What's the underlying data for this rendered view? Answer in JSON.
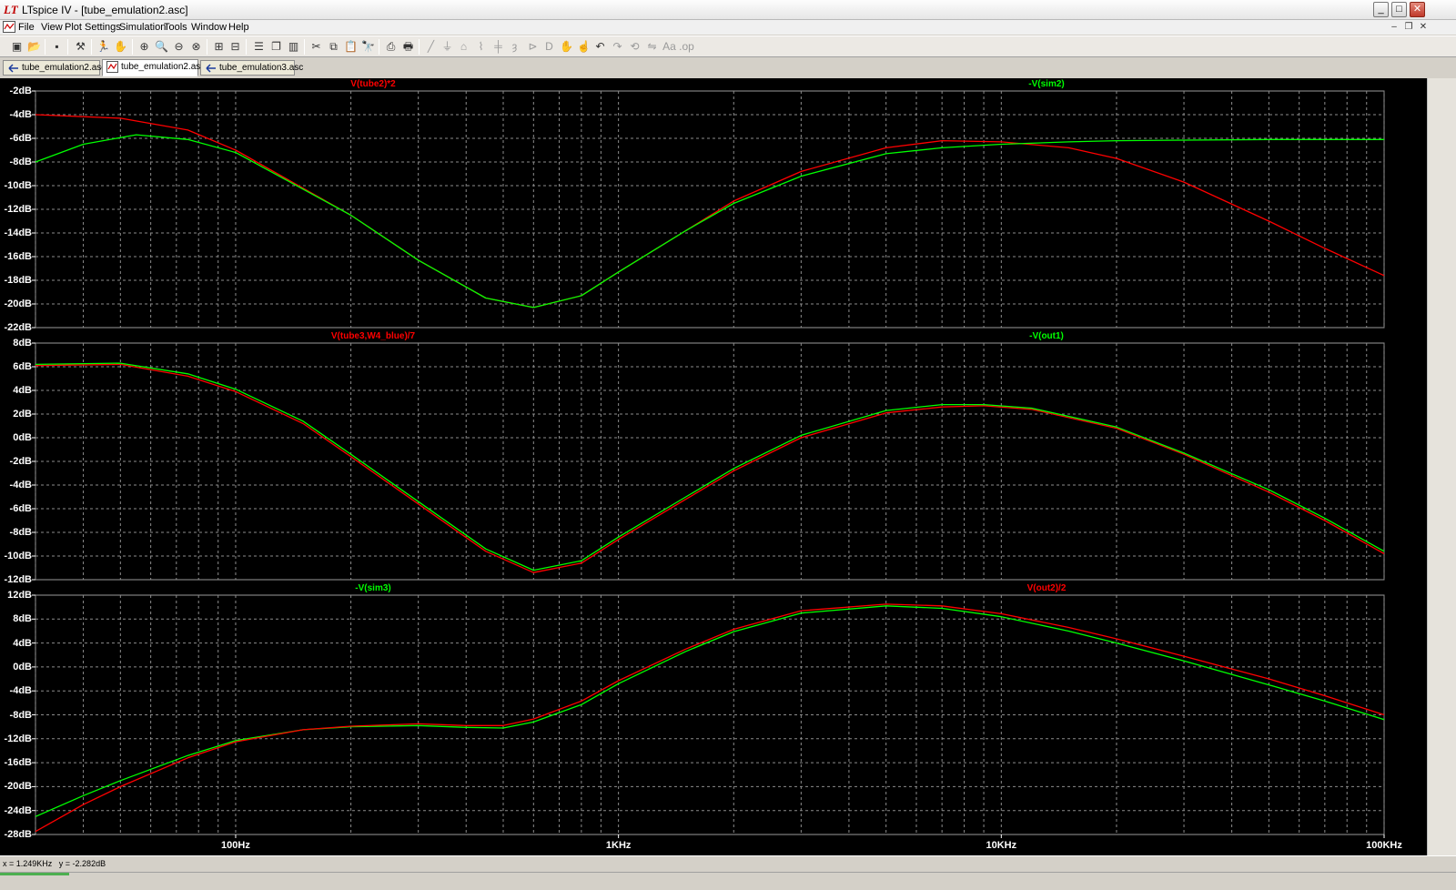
{
  "window": {
    "title": "LTspice IV - [tube_emulation2.asc]",
    "buttons": {
      "minimize": "_",
      "maximize": "□",
      "close": "✕"
    }
  },
  "menu": {
    "items": [
      "File",
      "View",
      "Plot Settings",
      "Simulation",
      "Tools",
      "Window",
      "Help"
    ],
    "mdi_buttons": [
      "–",
      "❐",
      "✕"
    ]
  },
  "toolbar": {
    "icons": [
      "new-schematic",
      "open",
      "save",
      "control-panel",
      "run",
      "halt",
      "zoom-in",
      "zoom-pan",
      "zoom-out",
      "zoom-fit",
      "autorange",
      "zoom-cancel",
      "tile-horizontal",
      "cascade",
      "tile-vertical",
      "cut",
      "copy",
      "paste",
      "find",
      "print-preview",
      "print",
      "wire",
      "ground",
      "label-net",
      "resistor",
      "capacitor",
      "inductor",
      "diode",
      "component",
      "move",
      "drag",
      "undo",
      "redo",
      "rotate",
      "mirror",
      "text",
      "spice-directive"
    ]
  },
  "tabs": [
    {
      "label": "tube_emulation2.asc",
      "kind": "schematic"
    },
    {
      "label": "tube_emulation2.asc",
      "kind": "waveform",
      "active": true
    },
    {
      "label": "tube_emulation3.asc",
      "kind": "schematic"
    }
  ],
  "status": {
    "x_readout": "x = 1.249KHz",
    "y_readout": "y = -2.282dB"
  },
  "colors": {
    "background": "#000000",
    "grid": "#8c8c8c",
    "red_trace": "#ff0000",
    "green_trace": "#00ff00"
  },
  "chart_data": [
    {
      "type": "line",
      "x_scale": "log",
      "xlim": [
        30,
        100000
      ],
      "ylim": [
        -22,
        -2
      ],
      "y_unit": "dB",
      "y_ticks": [
        "-2dB",
        "-4dB",
        "-6dB",
        "-8dB",
        "-10dB",
        "-12dB",
        "-14dB",
        "-16dB",
        "-18dB",
        "-20dB",
        "-22dB"
      ],
      "series": [
        {
          "name": "V(tube2)*2",
          "color": "red",
          "x": [
            30,
            50,
            75,
            100,
            200,
            300,
            450,
            600,
            800,
            1000,
            1500,
            2000,
            3000,
            5000,
            7000,
            10000,
            15000,
            20000,
            30000,
            50000,
            70000,
            100000
          ],
          "y": [
            -4.0,
            -4.3,
            -5.3,
            -7.0,
            -12.5,
            -16.3,
            -19.5,
            -20.3,
            -19.3,
            -17.3,
            -13.8,
            -11.3,
            -8.8,
            -6.8,
            -6.2,
            -6.3,
            -6.8,
            -7.7,
            -9.7,
            -13.0,
            -15.3,
            -17.6
          ]
        },
        {
          "name": "-V(sim2)",
          "color": "green",
          "x": [
            30,
            40,
            55,
            75,
            100,
            200,
            300,
            450,
            600,
            800,
            1000,
            1500,
            2000,
            3000,
            5000,
            7000,
            10000,
            15000,
            20000,
            50000,
            100000
          ],
          "y": [
            -8.0,
            -6.5,
            -5.7,
            -6.1,
            -7.2,
            -12.5,
            -16.3,
            -19.5,
            -20.3,
            -19.3,
            -17.3,
            -13.8,
            -11.5,
            -9.2,
            -7.3,
            -6.8,
            -6.5,
            -6.3,
            -6.2,
            -6.1,
            -6.1
          ]
        }
      ]
    },
    {
      "type": "line",
      "x_scale": "log",
      "xlim": [
        30,
        100000
      ],
      "ylim": [
        -12,
        8
      ],
      "y_unit": "dB",
      "y_ticks": [
        "8dB",
        "6dB",
        "4dB",
        "2dB",
        "0dB",
        "-2dB",
        "-4dB",
        "-6dB",
        "-8dB",
        "-10dB",
        "-12dB"
      ],
      "series": [
        {
          "name": "V(tube3,W4_blue)/7",
          "color": "red",
          "x": [
            30,
            50,
            75,
            100,
            150,
            200,
            300,
            450,
            600,
            800,
            1000,
            1500,
            2000,
            3000,
            5000,
            7000,
            9000,
            12000,
            20000,
            30000,
            50000,
            70000,
            100000
          ],
          "y": [
            6.1,
            6.2,
            5.2,
            3.9,
            1.2,
            -1.6,
            -5.6,
            -9.6,
            -11.4,
            -10.6,
            -8.6,
            -5.2,
            -2.8,
            0.0,
            2.1,
            2.6,
            2.7,
            2.4,
            0.8,
            -1.4,
            -4.6,
            -7.0,
            -9.8
          ]
        },
        {
          "name": "-V(out1)",
          "color": "green",
          "x": [
            30,
            50,
            75,
            100,
            150,
            200,
            300,
            450,
            600,
            800,
            1000,
            1500,
            2000,
            3000,
            5000,
            7000,
            9000,
            12000,
            20000,
            30000,
            50000,
            70000,
            100000
          ],
          "y": [
            6.2,
            6.3,
            5.4,
            4.1,
            1.4,
            -1.4,
            -5.4,
            -9.4,
            -11.2,
            -10.4,
            -8.4,
            -5.0,
            -2.6,
            0.2,
            2.3,
            2.8,
            2.8,
            2.5,
            0.9,
            -1.3,
            -4.4,
            -6.8,
            -9.6
          ]
        }
      ]
    },
    {
      "type": "line",
      "x_scale": "log",
      "xlim": [
        30,
        100000
      ],
      "ylim": [
        -28,
        12
      ],
      "y_unit": "dB",
      "y_ticks": [
        "12dB",
        "8dB",
        "4dB",
        "0dB",
        "-4dB",
        "-8dB",
        "-12dB",
        "-16dB",
        "-20dB",
        "-24dB",
        "-28dB"
      ],
      "series": [
        {
          "name": "-V(sim3)",
          "color": "green",
          "x": [
            30,
            40,
            50,
            75,
            100,
            150,
            200,
            300,
            400,
            500,
            600,
            800,
            1000,
            1500,
            2000,
            3000,
            5000,
            7000,
            10000,
            15000,
            20000,
            30000,
            50000,
            70000,
            100000
          ],
          "y": [
            -25.0,
            -21.5,
            -19.0,
            -14.8,
            -12.3,
            -10.5,
            -10.0,
            -9.8,
            -10.1,
            -10.2,
            -9.2,
            -6.3,
            -2.8,
            2.6,
            5.9,
            9.0,
            10.2,
            9.8,
            8.4,
            6.0,
            4.0,
            1.0,
            -3.0,
            -5.7,
            -8.8
          ]
        },
        {
          "name": "V(out2)/2",
          "color": "red",
          "x": [
            30,
            40,
            50,
            75,
            100,
            150,
            200,
            300,
            400,
            500,
            600,
            800,
            1000,
            1500,
            2000,
            3000,
            5000,
            7000,
            10000,
            15000,
            20000,
            30000,
            50000,
            70000,
            100000
          ],
          "y": [
            -27.5,
            -23.0,
            -20.0,
            -15.2,
            -12.5,
            -10.5,
            -9.9,
            -9.5,
            -9.8,
            -9.8,
            -8.7,
            -5.7,
            -2.3,
            3.0,
            6.3,
            9.4,
            10.5,
            10.2,
            8.9,
            6.6,
            4.7,
            1.8,
            -2.0,
            -4.8,
            -8.0
          ]
        }
      ]
    }
  ],
  "x_axis": {
    "ticks": [
      {
        "label": "100Hz",
        "value": 100
      },
      {
        "label": "1KHz",
        "value": 1000
      },
      {
        "label": "10KHz",
        "value": 10000
      },
      {
        "label": "100KHz",
        "value": 100000
      }
    ]
  }
}
